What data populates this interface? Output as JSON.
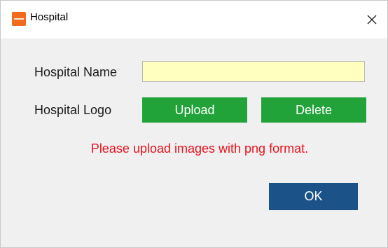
{
  "window": {
    "title": "Hospital",
    "icon": "app-logo-icon",
    "close_icon": "close-icon"
  },
  "form": {
    "name_label": "Hospital Name",
    "name_value": "",
    "logo_label": "Hospital Logo",
    "upload_label": "Upload",
    "delete_label": "Delete",
    "hint": "Please upload images with png format."
  },
  "footer": {
    "ok_label": "OK"
  },
  "colors": {
    "title_icon": "#f26a1b",
    "input_background": "#ffffc0",
    "action_buttons": "#22a33a",
    "hint_text": "#e8131f",
    "ok_button": "#1b5388"
  }
}
